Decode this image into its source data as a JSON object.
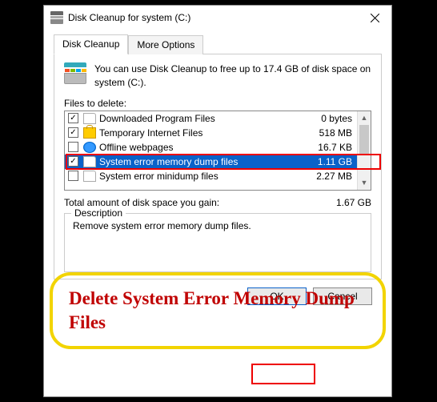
{
  "titlebar": {
    "text": "Disk Cleanup for system (C:)"
  },
  "tabs": {
    "active": "Disk Cleanup",
    "inactive": "More Options"
  },
  "info": {
    "text": "You can use Disk Cleanup to free up to 17.4 GB of disk space on system (C:)."
  },
  "files_label": "Files to delete:",
  "files": [
    {
      "checked": true,
      "icon": "file",
      "name": "Downloaded Program Files",
      "size": "0 bytes",
      "selected": false
    },
    {
      "checked": true,
      "icon": "lock",
      "name": "Temporary Internet Files",
      "size": "518 MB",
      "selected": false
    },
    {
      "checked": false,
      "icon": "globe",
      "name": "Offline webpages",
      "size": "16.7 KB",
      "selected": false
    },
    {
      "checked": true,
      "icon": "file",
      "name": "System error memory dump files",
      "size": "1.11 GB",
      "selected": true
    },
    {
      "checked": false,
      "icon": "file",
      "name": "System error minidump files",
      "size": "2.27 MB",
      "selected": false
    }
  ],
  "total": {
    "label": "Total amount of disk space you gain:",
    "value": "1.67 GB"
  },
  "description": {
    "legend": "Description",
    "text": "Remove system error memory dump files."
  },
  "buttons": {
    "ok": "OK",
    "cancel": "Cancel"
  },
  "annotation": {
    "callout": "Delete System Error Memory Dump Files"
  }
}
